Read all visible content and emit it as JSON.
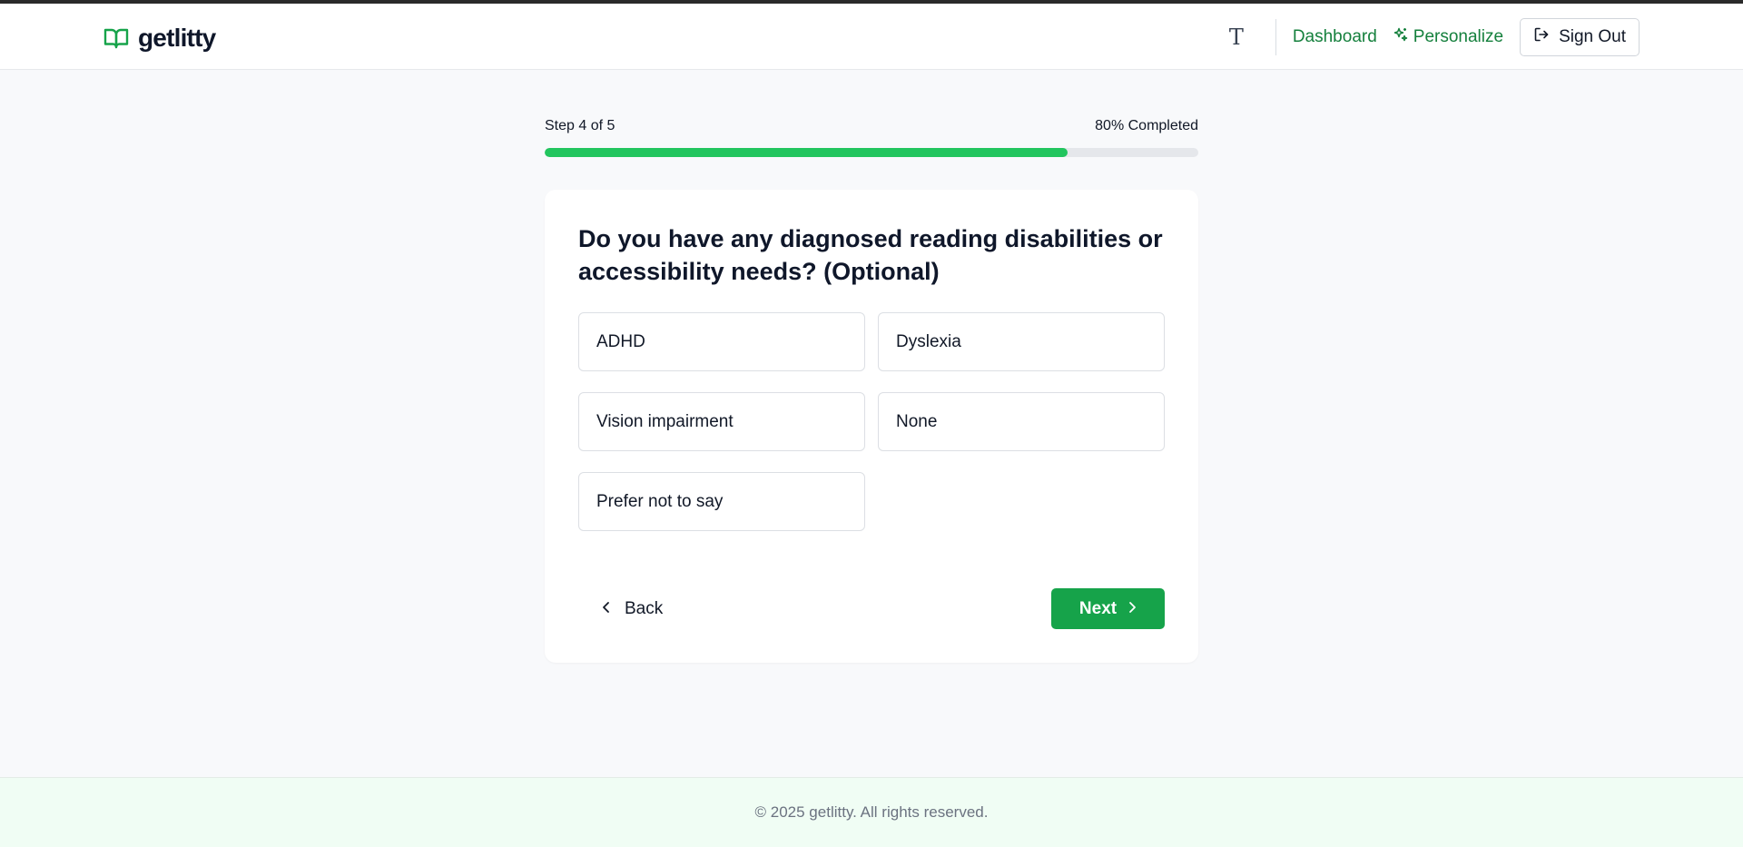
{
  "header": {
    "logo_text": "getlitty",
    "font_toggle_glyph": "T",
    "nav": {
      "dashboard": "Dashboard",
      "personalize": "Personalize",
      "sign_out": "Sign Out"
    }
  },
  "progress": {
    "step_label": "Step 4 of 5",
    "percent_label": "80% Completed",
    "fraction": 0.8
  },
  "question": {
    "title": "Do you have any diagnosed reading disabilities or accessibility needs? (Optional)",
    "options": [
      "ADHD",
      "Dyslexia",
      "Vision impairment",
      "None",
      "Prefer not to say"
    ]
  },
  "actions": {
    "back": "Back",
    "next": "Next"
  },
  "footer": {
    "copyright": "© 2025 getlitty. All rights reserved."
  },
  "colors": {
    "brand_green": "#16a34a",
    "progress_green": "#22c55e",
    "link_green": "#15803d"
  },
  "icons": {
    "logo": "book-open-icon",
    "personalize": "sparkles-icon",
    "sign_out": "log-out-icon",
    "back": "chevron-left-icon",
    "next": "chevron-right-icon"
  }
}
